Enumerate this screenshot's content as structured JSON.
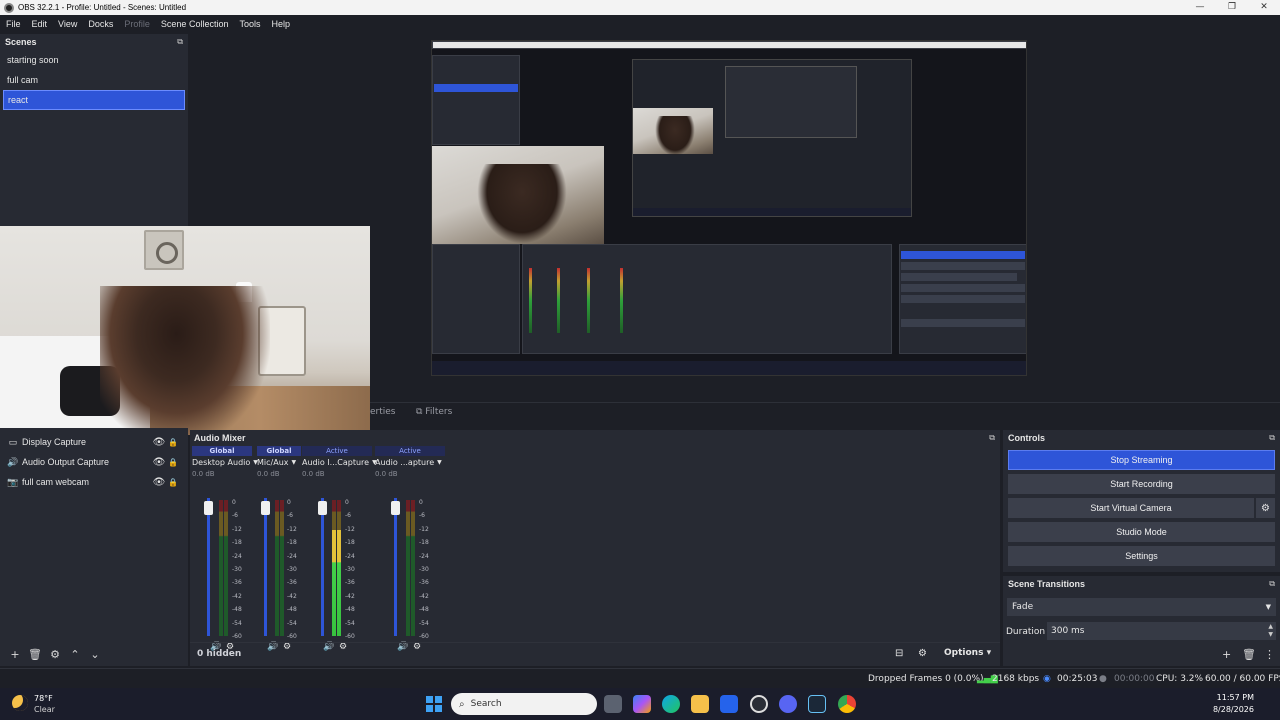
{
  "window": {
    "title": "OBS 32.2.1 - Profile: Untitled - Scenes: Untitled",
    "controls": [
      "—",
      "❐",
      "✕"
    ]
  },
  "menu": [
    {
      "label": "File",
      "enabled": true
    },
    {
      "label": "Edit",
      "enabled": true
    },
    {
      "label": "View",
      "enabled": true
    },
    {
      "label": "Docks",
      "enabled": true
    },
    {
      "label": "Profile",
      "enabled": false
    },
    {
      "label": "Scene Collection",
      "enabled": true
    },
    {
      "label": "Tools",
      "enabled": true
    },
    {
      "label": "Help",
      "enabled": true
    }
  ],
  "scenes": {
    "title": "Scenes",
    "items": [
      "starting soon",
      "full cam",
      "react"
    ],
    "selected": "react"
  },
  "tabs": {
    "properties": "erties",
    "filters": "Filters"
  },
  "sources": {
    "items": [
      {
        "label": "Display Capture",
        "icon": "monitor-icon"
      },
      {
        "label": "Audio Output Capture",
        "icon": "speaker-icon"
      },
      {
        "label": "full cam webcam",
        "icon": "camera-icon"
      }
    ]
  },
  "mixer": {
    "title": "Audio Mixer",
    "scale": [
      "0",
      "-6",
      "-12",
      "-18",
      "-24",
      "-30",
      "-36",
      "-42",
      "-48",
      "-54",
      "-60"
    ],
    "channels": [
      {
        "badge": "Global",
        "name": "Desktop Audio",
        "db": "0.0 dB",
        "level": 0.0
      },
      {
        "badge": "Global",
        "name": "Mic/Aux",
        "db": "0.0 dB",
        "level": 0.0
      },
      {
        "badge": "Active",
        "name": "Audio I...Capture",
        "db": "0.0 dB",
        "level": 0.78
      },
      {
        "badge": "Active",
        "name": "Audio ...apture",
        "db": "0.0 dB",
        "level": 0.0
      }
    ],
    "hidden_count": "0 hidden",
    "options_label": "Options"
  },
  "controls": {
    "title": "Controls",
    "stop_streaming": "Stop Streaming",
    "start_recording": "Start Recording",
    "start_virtual_camera": "Start Virtual Camera",
    "studio_mode": "Studio Mode",
    "settings": "Settings"
  },
  "transitions": {
    "title": "Scene Transitions",
    "selected": "Fade",
    "duration_label": "Duration",
    "duration_value": "300 ms"
  },
  "status": {
    "dropped_frames": "Dropped Frames 0 (0.0%)",
    "bitrate": "2168 kbps",
    "stream_time": "00:25:03",
    "record_time": "00:00:00",
    "cpu": "CPU: 3.2%",
    "fps": "60.00 / 60.00 FPS"
  },
  "taskbar": {
    "temperature": "78°F",
    "weather": "Clear",
    "search_placeholder": "Search",
    "time": "11:57 PM",
    "date": "8/28/2026"
  },
  "colors": {
    "accent": "#2e55d8",
    "background": "#1d1f26",
    "panel": "#272a33",
    "button": "#3b3f4b"
  }
}
